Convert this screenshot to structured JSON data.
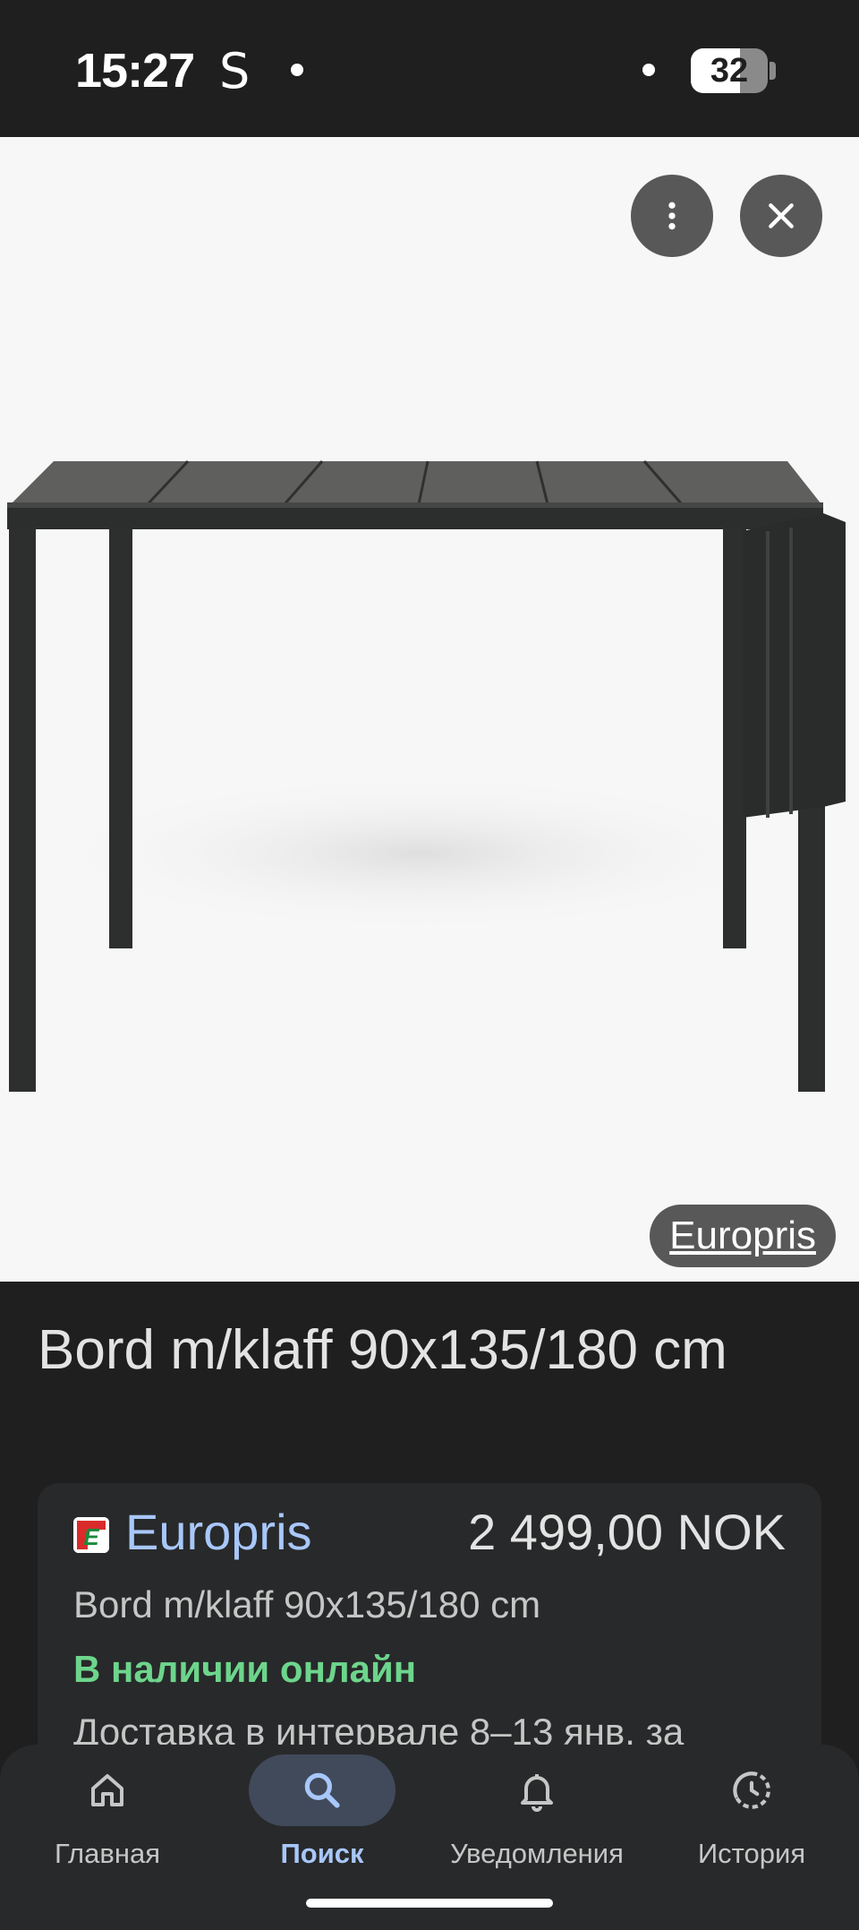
{
  "status_bar": {
    "time": "15:27",
    "carrier_icon_text": "S",
    "battery_level": "32",
    "battery_fraction": 0.32
  },
  "viewer": {
    "more_icon": "more-vert-icon",
    "close_icon": "close-icon",
    "source_label": "Europris"
  },
  "product": {
    "title": "Bord m/klaff 90x135/180 cm"
  },
  "offer": {
    "merchant": "Europris",
    "price": "2 499,00 NOK",
    "description": "Bord m/klaff 90x135/180 cm",
    "stock": "В наличии онлайн",
    "delivery": "Доставка в интервале 8–13 янв. за",
    "stock_color": "#6dd58c",
    "merchant_color": "#a8c7fa"
  },
  "nav": {
    "items": [
      {
        "label": "Главная",
        "icon": "home-icon"
      },
      {
        "label": "Поиск",
        "icon": "search-icon",
        "active": true
      },
      {
        "label": "Уведомления",
        "icon": "bell-icon"
      },
      {
        "label": "История",
        "icon": "history-icon"
      }
    ]
  }
}
